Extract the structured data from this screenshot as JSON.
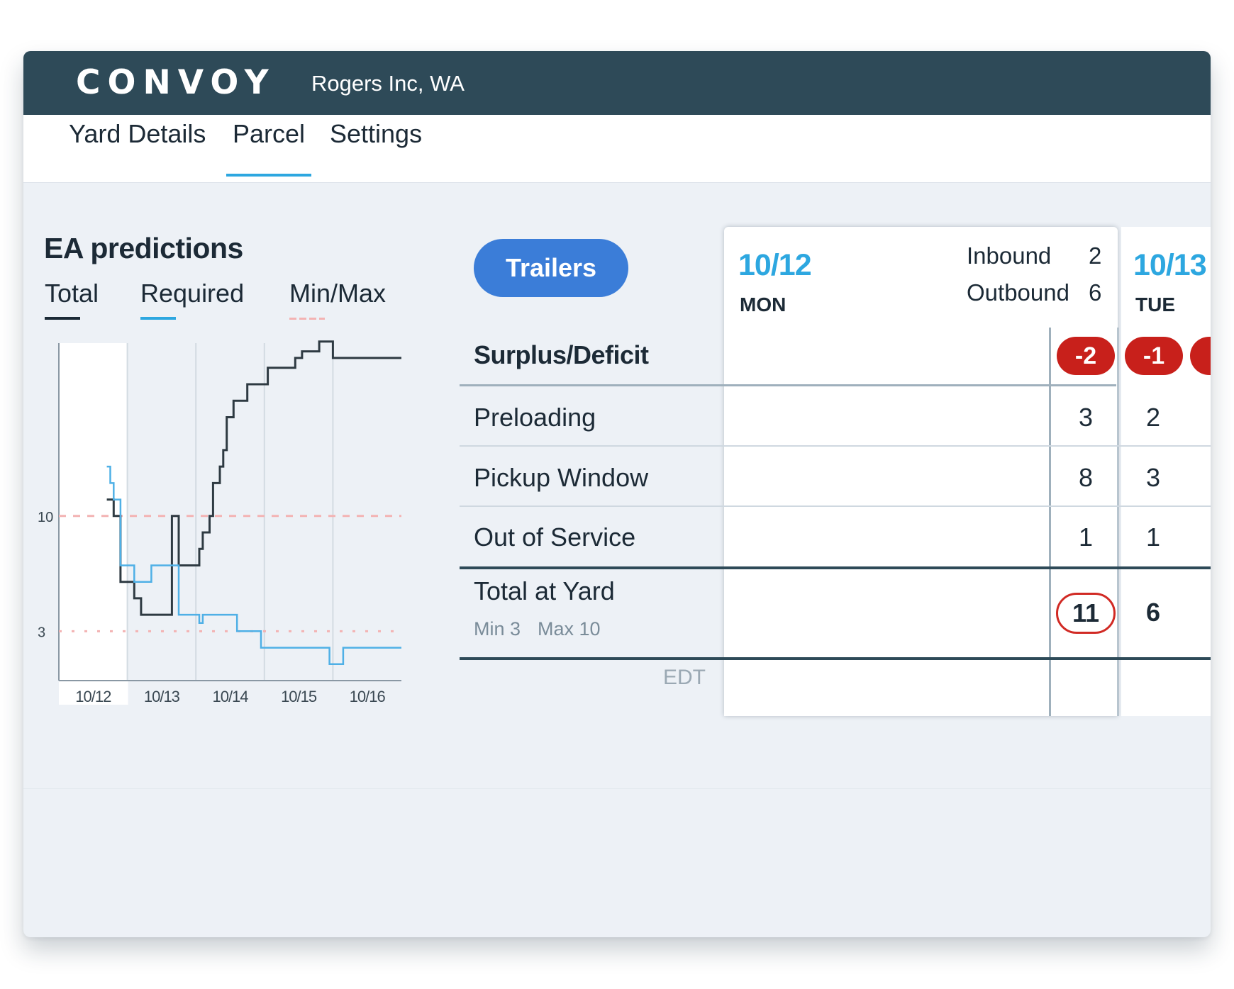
{
  "app": {
    "logo": "CONVOY",
    "company": "Rogers Inc, WA"
  },
  "tabs": [
    {
      "label": "Yard Details"
    },
    {
      "label": "Parcel",
      "active": true
    },
    {
      "label": "Settings"
    }
  ],
  "colors": {
    "header_bg": "#2e4a58",
    "accent_blue": "#2da7e0",
    "button_blue": "#3b7dd8",
    "deficit_red": "#c8201b",
    "total_line": "#2e3a42",
    "required_line": "#4fb0e6",
    "minmax_line": "#f3b3b3"
  },
  "predictions": {
    "title": "EA predictions",
    "legend": [
      "Total",
      "Required",
      "Min/Max"
    ]
  },
  "chart_data": {
    "type": "line",
    "title": "",
    "xlabel": "",
    "ylabel": "",
    "x_tick_labels": [
      "10/12",
      "10/13",
      "10/14",
      "10/15",
      "10/16"
    ],
    "y_tick_labels": [
      "10",
      "3"
    ],
    "ylim": [
      0,
      20.5
    ],
    "xlim": [
      10.12,
      10.17
    ],
    "min": 3,
    "max": 10,
    "grid": "vertical",
    "series": [
      {
        "name": "Total",
        "color": "#2e3a42",
        "points": [
          [
            10.127,
            11
          ],
          [
            10.128,
            11
          ],
          [
            10.128,
            10
          ],
          [
            10.129,
            10
          ],
          [
            10.129,
            6
          ],
          [
            10.131,
            6
          ],
          [
            10.131,
            5
          ],
          [
            10.132,
            5
          ],
          [
            10.132,
            4
          ],
          [
            10.1365,
            4
          ],
          [
            10.1365,
            10
          ],
          [
            10.1375,
            10
          ],
          [
            10.1375,
            7
          ],
          [
            10.1405,
            7
          ],
          [
            10.1405,
            8
          ],
          [
            10.141,
            8
          ],
          [
            10.141,
            9
          ],
          [
            10.142,
            9
          ],
          [
            10.142,
            10
          ],
          [
            10.1425,
            10
          ],
          [
            10.1425,
            12
          ],
          [
            10.1435,
            12
          ],
          [
            10.1435,
            13
          ],
          [
            10.144,
            13
          ],
          [
            10.144,
            14
          ],
          [
            10.1445,
            14
          ],
          [
            10.1445,
            16
          ],
          [
            10.1455,
            16
          ],
          [
            10.1455,
            17
          ],
          [
            10.1475,
            17
          ],
          [
            10.1475,
            18
          ],
          [
            10.1505,
            18
          ],
          [
            10.1505,
            19
          ],
          [
            10.1545,
            19
          ],
          [
            10.1545,
            19.6
          ],
          [
            10.1555,
            19.6
          ],
          [
            10.1555,
            20
          ],
          [
            10.158,
            20
          ],
          [
            10.158,
            20.6
          ],
          [
            10.16,
            20.6
          ],
          [
            10.16,
            19.6
          ],
          [
            10.17,
            19.6
          ]
        ]
      },
      {
        "name": "Required",
        "color": "#4fb0e6",
        "points": [
          [
            10.127,
            13
          ],
          [
            10.1275,
            13
          ],
          [
            10.1275,
            12
          ],
          [
            10.128,
            12
          ],
          [
            10.128,
            11
          ],
          [
            10.129,
            11
          ],
          [
            10.129,
            7
          ],
          [
            10.131,
            7
          ],
          [
            10.131,
            6
          ],
          [
            10.1335,
            6
          ],
          [
            10.1335,
            7
          ],
          [
            10.1375,
            7
          ],
          [
            10.1375,
            4
          ],
          [
            10.1405,
            4
          ],
          [
            10.1405,
            3.5
          ],
          [
            10.141,
            3.5
          ],
          [
            10.141,
            4
          ],
          [
            10.146,
            4
          ],
          [
            10.146,
            3
          ],
          [
            10.1495,
            3
          ],
          [
            10.1495,
            2
          ],
          [
            10.1595,
            2
          ],
          [
            10.1595,
            1
          ],
          [
            10.1615,
            1
          ],
          [
            10.1615,
            2
          ],
          [
            10.17,
            2
          ]
        ]
      }
    ]
  },
  "trailers_button": "Trailers",
  "rows": {
    "surplus": "Surplus/Deficit",
    "preloading": "Preloading",
    "pickup": "Pickup Window",
    "oos": "Out of Service",
    "total": "Total at Yard",
    "min": "Min 3",
    "max": "Max 10",
    "timezone": "EDT"
  },
  "days": [
    {
      "date": "10/12",
      "dow": "MON",
      "inbound_label": "Inbound",
      "inbound": "2",
      "outbound_label": "Outbound",
      "outbound": "6",
      "surplus": "-2",
      "preloading": "3",
      "pickup": "8",
      "oos": "1",
      "total": "11"
    },
    {
      "date": "10/13",
      "dow": "TUE",
      "surplus": "-1",
      "preloading": "2",
      "pickup": "3",
      "oos": "1",
      "total": "6"
    }
  ]
}
